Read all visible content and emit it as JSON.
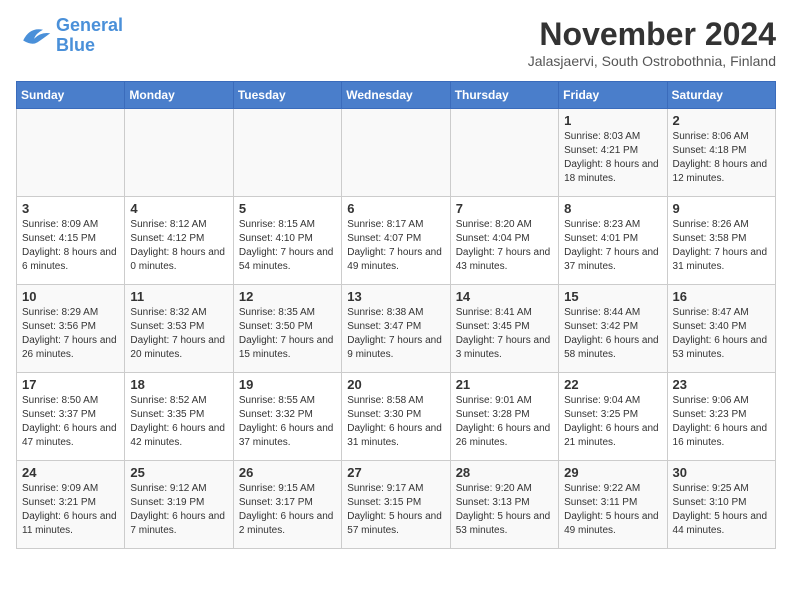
{
  "logo": {
    "line1": "General",
    "line2": "Blue"
  },
  "title": "November 2024",
  "subtitle": "Jalasjaervi, South Ostrobothnia, Finland",
  "days_of_week": [
    "Sunday",
    "Monday",
    "Tuesday",
    "Wednesday",
    "Thursday",
    "Friday",
    "Saturday"
  ],
  "rows": [
    [
      {
        "day": "",
        "info": ""
      },
      {
        "day": "",
        "info": ""
      },
      {
        "day": "",
        "info": ""
      },
      {
        "day": "",
        "info": ""
      },
      {
        "day": "",
        "info": ""
      },
      {
        "day": "1",
        "info": "Sunrise: 8:03 AM\nSunset: 4:21 PM\nDaylight: 8 hours and 18 minutes."
      },
      {
        "day": "2",
        "info": "Sunrise: 8:06 AM\nSunset: 4:18 PM\nDaylight: 8 hours and 12 minutes."
      }
    ],
    [
      {
        "day": "3",
        "info": "Sunrise: 8:09 AM\nSunset: 4:15 PM\nDaylight: 8 hours and 6 minutes."
      },
      {
        "day": "4",
        "info": "Sunrise: 8:12 AM\nSunset: 4:12 PM\nDaylight: 8 hours and 0 minutes."
      },
      {
        "day": "5",
        "info": "Sunrise: 8:15 AM\nSunset: 4:10 PM\nDaylight: 7 hours and 54 minutes."
      },
      {
        "day": "6",
        "info": "Sunrise: 8:17 AM\nSunset: 4:07 PM\nDaylight: 7 hours and 49 minutes."
      },
      {
        "day": "7",
        "info": "Sunrise: 8:20 AM\nSunset: 4:04 PM\nDaylight: 7 hours and 43 minutes."
      },
      {
        "day": "8",
        "info": "Sunrise: 8:23 AM\nSunset: 4:01 PM\nDaylight: 7 hours and 37 minutes."
      },
      {
        "day": "9",
        "info": "Sunrise: 8:26 AM\nSunset: 3:58 PM\nDaylight: 7 hours and 31 minutes."
      }
    ],
    [
      {
        "day": "10",
        "info": "Sunrise: 8:29 AM\nSunset: 3:56 PM\nDaylight: 7 hours and 26 minutes."
      },
      {
        "day": "11",
        "info": "Sunrise: 8:32 AM\nSunset: 3:53 PM\nDaylight: 7 hours and 20 minutes."
      },
      {
        "day": "12",
        "info": "Sunrise: 8:35 AM\nSunset: 3:50 PM\nDaylight: 7 hours and 15 minutes."
      },
      {
        "day": "13",
        "info": "Sunrise: 8:38 AM\nSunset: 3:47 PM\nDaylight: 7 hours and 9 minutes."
      },
      {
        "day": "14",
        "info": "Sunrise: 8:41 AM\nSunset: 3:45 PM\nDaylight: 7 hours and 3 minutes."
      },
      {
        "day": "15",
        "info": "Sunrise: 8:44 AM\nSunset: 3:42 PM\nDaylight: 6 hours and 58 minutes."
      },
      {
        "day": "16",
        "info": "Sunrise: 8:47 AM\nSunset: 3:40 PM\nDaylight: 6 hours and 53 minutes."
      }
    ],
    [
      {
        "day": "17",
        "info": "Sunrise: 8:50 AM\nSunset: 3:37 PM\nDaylight: 6 hours and 47 minutes."
      },
      {
        "day": "18",
        "info": "Sunrise: 8:52 AM\nSunset: 3:35 PM\nDaylight: 6 hours and 42 minutes."
      },
      {
        "day": "19",
        "info": "Sunrise: 8:55 AM\nSunset: 3:32 PM\nDaylight: 6 hours and 37 minutes."
      },
      {
        "day": "20",
        "info": "Sunrise: 8:58 AM\nSunset: 3:30 PM\nDaylight: 6 hours and 31 minutes."
      },
      {
        "day": "21",
        "info": "Sunrise: 9:01 AM\nSunset: 3:28 PM\nDaylight: 6 hours and 26 minutes."
      },
      {
        "day": "22",
        "info": "Sunrise: 9:04 AM\nSunset: 3:25 PM\nDaylight: 6 hours and 21 minutes."
      },
      {
        "day": "23",
        "info": "Sunrise: 9:06 AM\nSunset: 3:23 PM\nDaylight: 6 hours and 16 minutes."
      }
    ],
    [
      {
        "day": "24",
        "info": "Sunrise: 9:09 AM\nSunset: 3:21 PM\nDaylight: 6 hours and 11 minutes."
      },
      {
        "day": "25",
        "info": "Sunrise: 9:12 AM\nSunset: 3:19 PM\nDaylight: 6 hours and 7 minutes."
      },
      {
        "day": "26",
        "info": "Sunrise: 9:15 AM\nSunset: 3:17 PM\nDaylight: 6 hours and 2 minutes."
      },
      {
        "day": "27",
        "info": "Sunrise: 9:17 AM\nSunset: 3:15 PM\nDaylight: 5 hours and 57 minutes."
      },
      {
        "day": "28",
        "info": "Sunrise: 9:20 AM\nSunset: 3:13 PM\nDaylight: 5 hours and 53 minutes."
      },
      {
        "day": "29",
        "info": "Sunrise: 9:22 AM\nSunset: 3:11 PM\nDaylight: 5 hours and 49 minutes."
      },
      {
        "day": "30",
        "info": "Sunrise: 9:25 AM\nSunset: 3:10 PM\nDaylight: 5 hours and 44 minutes."
      }
    ]
  ]
}
